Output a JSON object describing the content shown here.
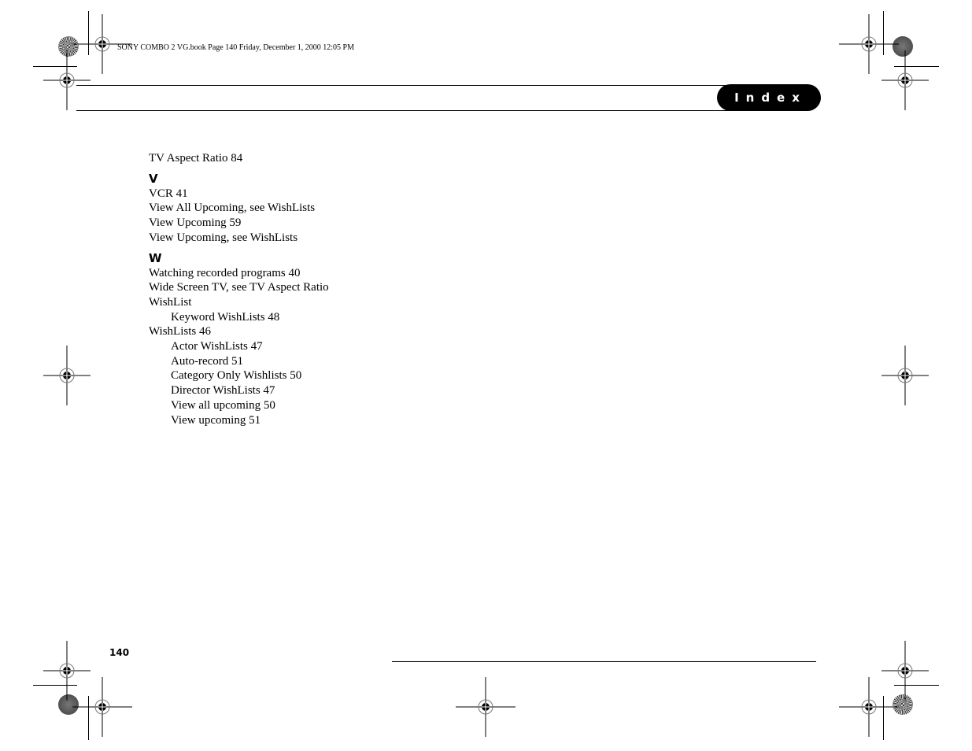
{
  "header": {
    "slug_text": "SONY COMBO 2 VG.book  Page 140  Friday, December 1, 2000  12:05 PM",
    "section_tab": "Index"
  },
  "index": {
    "lead_entries": [
      {
        "text": "TV Aspect Ratio 84"
      }
    ],
    "sections": [
      {
        "letter": "V",
        "entries": [
          {
            "text": "VCR 41",
            "level": 0
          },
          {
            "text": "View All Upcoming, see WishLists",
            "level": 0
          },
          {
            "text": "View Upcoming 59",
            "level": 0
          },
          {
            "text": "View Upcoming, see WishLists",
            "level": 0
          }
        ]
      },
      {
        "letter": "W",
        "entries": [
          {
            "text": "Watching recorded programs 40",
            "level": 0
          },
          {
            "text": "Wide Screen TV, see TV Aspect Ratio",
            "level": 0
          },
          {
            "text": "WishList",
            "level": 0
          },
          {
            "text": "Keyword WishLists 48",
            "level": 1
          },
          {
            "text": "WishLists 46",
            "level": 0
          },
          {
            "text": "Actor WishLists 47",
            "level": 1
          },
          {
            "text": "Auto-record 51",
            "level": 1
          },
          {
            "text": "Category Only Wishlists 50",
            "level": 1
          },
          {
            "text": "Director WishLists 47",
            "level": 1
          },
          {
            "text": "View all upcoming 50",
            "level": 1
          },
          {
            "text": "View upcoming 51",
            "level": 1
          }
        ]
      }
    ]
  },
  "footer": {
    "page_number": "140"
  },
  "marks": {
    "registration": "registration-crosshair-icon",
    "starburst": "color-bar-starburst-icon",
    "solid_disc": "gray-disc-icon"
  }
}
